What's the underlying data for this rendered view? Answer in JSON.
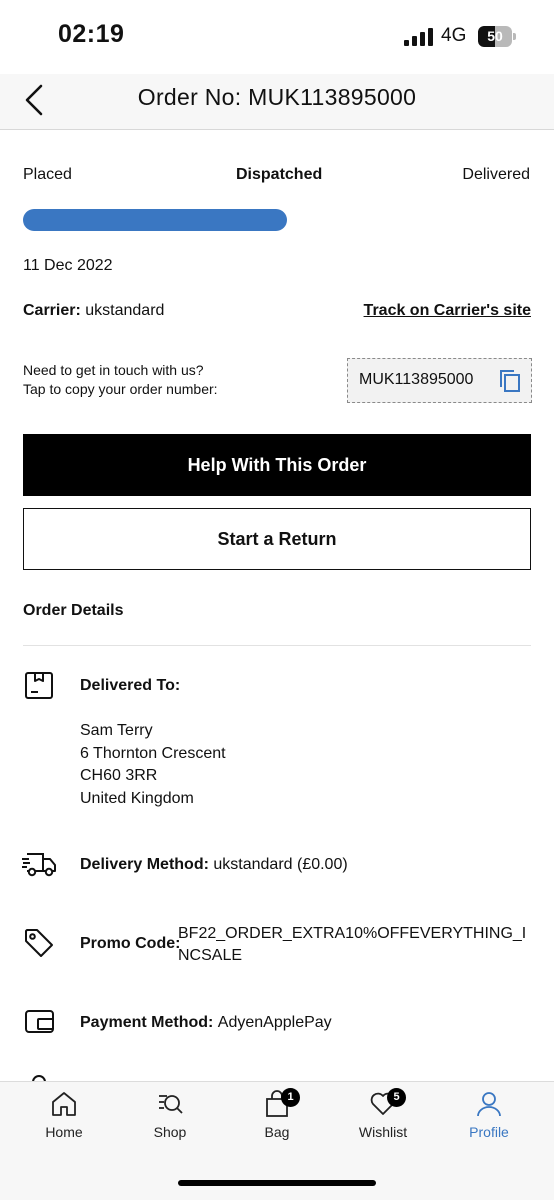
{
  "status_bar": {
    "time": "02:19",
    "network": "4G",
    "battery_level": "50",
    "battery_fraction": 0.5
  },
  "header": {
    "back_icon": "chevron-left-icon",
    "title": "Order No: MUK113895000"
  },
  "tracking": {
    "steps": [
      "Placed",
      "Dispatched",
      "Delivered"
    ],
    "current_step": "Dispatched",
    "progress_fraction": 0.52,
    "progress_color": "#3a77c2",
    "date": "11 Dec 2022",
    "carrier_label": "Carrier:",
    "carrier_value": "ukstandard",
    "track_link": "Track on Carrier's site"
  },
  "contact": {
    "line1": "Need to get in touch with us?",
    "line2": "Tap to copy your order number:",
    "order_number": "MUK113895000",
    "copy_icon": "copy-icon"
  },
  "actions": {
    "help_label": "Help With This Order",
    "return_label": "Start a Return"
  },
  "order_details": {
    "title": "Order Details",
    "delivered_to": {
      "icon": "package-icon",
      "label": "Delivered To:",
      "name": "Sam Terry",
      "street": "6 Thornton Crescent",
      "postcode": "CH60 3RR",
      "country": "United Kingdom"
    },
    "delivery_method": {
      "icon": "delivery-truck-icon",
      "label": "Delivery Method:",
      "value": "ukstandard (£0.00)"
    },
    "promo_code": {
      "icon": "tag-icon",
      "label": "Promo Code:",
      "value": "BF22_ORDER_EXTRA10%OFFEVERYTHING_INCSALE"
    },
    "payment_method": {
      "icon": "wallet-icon",
      "label": "Payment Method:",
      "value": "AdyenApplePay"
    }
  },
  "tabbar": {
    "items": [
      {
        "label": "Home",
        "icon": "home-icon"
      },
      {
        "label": "Shop",
        "icon": "search-icon"
      },
      {
        "label": "Bag",
        "icon": "bag-icon",
        "badge": "1"
      },
      {
        "label": "Wishlist",
        "icon": "heart-icon",
        "badge": "5"
      },
      {
        "label": "Profile",
        "icon": "profile-icon",
        "active": true
      }
    ],
    "active_color": "#3a77c2"
  }
}
